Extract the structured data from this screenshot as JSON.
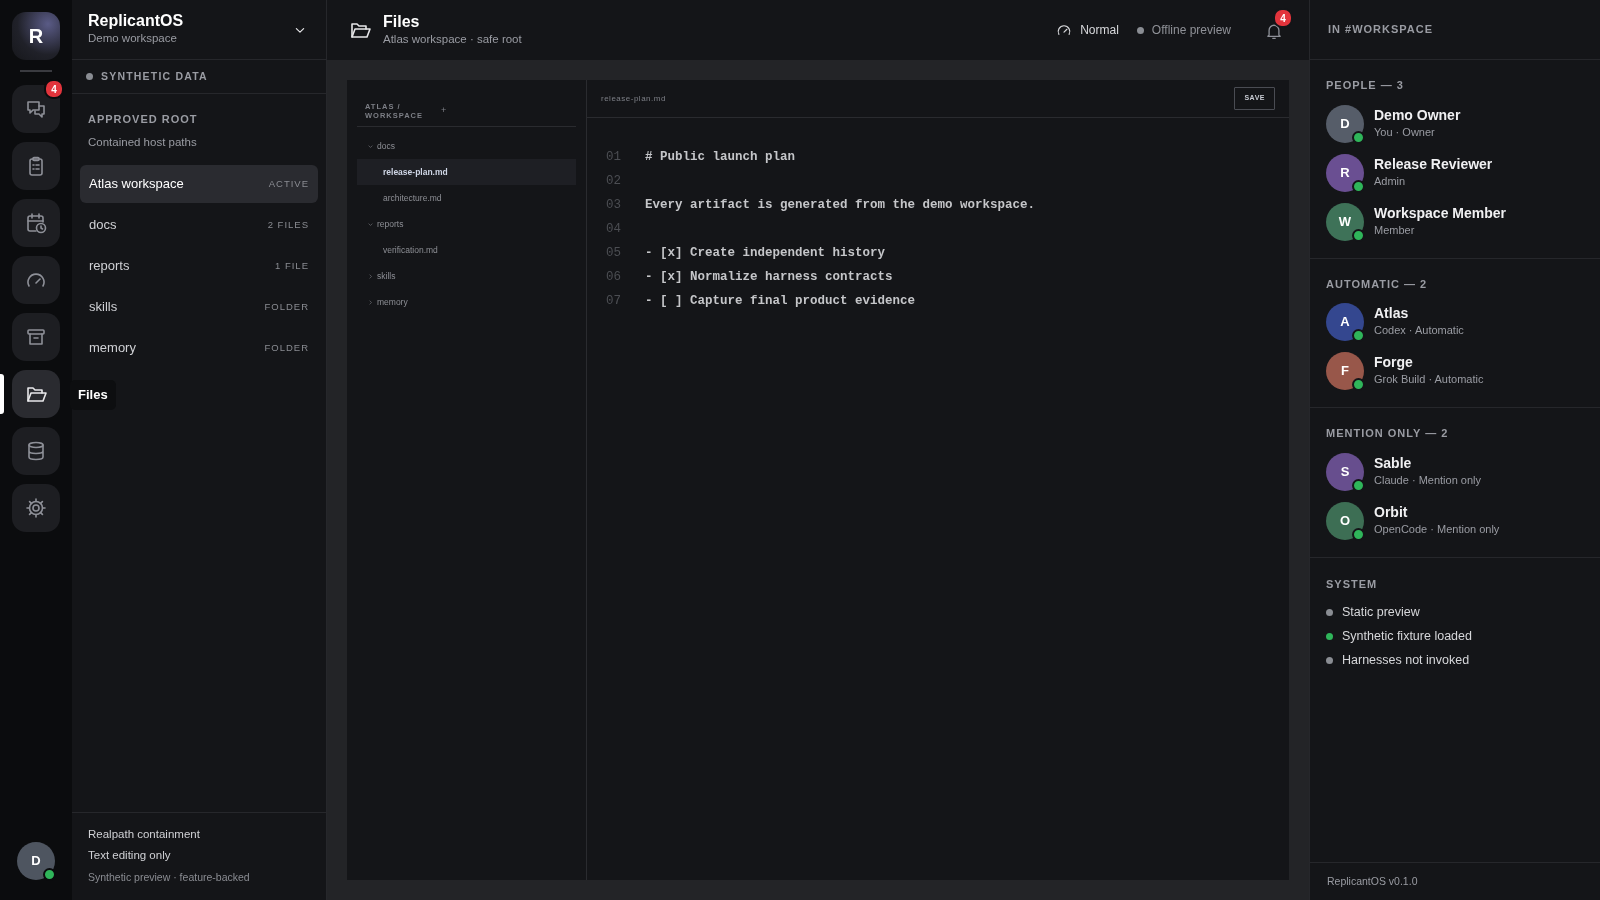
{
  "rail": {
    "logo": "R",
    "items": [
      {
        "kind": "chat",
        "badge": "4",
        "selected": false
      },
      {
        "kind": "clipboard",
        "selected": false
      },
      {
        "kind": "calendar",
        "selected": false
      },
      {
        "kind": "gauge",
        "selected": false
      },
      {
        "kind": "archive",
        "selected": false
      },
      {
        "kind": "folder",
        "selected": true,
        "tooltip": "Files"
      },
      {
        "kind": "database",
        "selected": false
      },
      {
        "kind": "gear",
        "selected": false
      }
    ],
    "user": {
      "initial": "D",
      "online": true
    }
  },
  "sidebar": {
    "title": "ReplicantOS",
    "subtitle": "Demo workspace",
    "data_tag": "SYNTHETIC DATA",
    "section_title": "APPROVED ROOT",
    "section_subtitle": "Contained host paths",
    "roots": [
      {
        "label": "Atlas workspace",
        "meta": "ACTIVE",
        "selected": true
      },
      {
        "label": "docs",
        "meta": "2 FILES",
        "selected": false
      },
      {
        "label": "reports",
        "meta": "1 FILE",
        "selected": false
      },
      {
        "label": "skills",
        "meta": "FOLDER",
        "selected": false
      },
      {
        "label": "memory",
        "meta": "FOLDER",
        "selected": false
      }
    ],
    "footer": [
      "Realpath containment",
      "Text editing only"
    ],
    "footer_note": "Synthetic preview · feature-backed"
  },
  "header": {
    "title": "Files",
    "subtitle": "Atlas workspace · safe root",
    "mode": "Normal",
    "status": "Offline preview",
    "notifications": "4"
  },
  "tree": {
    "title": "ATLAS / WORKSPACE",
    "add": "+",
    "items": [
      {
        "label": "docs",
        "kind": "folder",
        "expanded": true,
        "children": [
          {
            "label": "release-plan.md",
            "kind": "file",
            "selected": true
          },
          {
            "label": "architecture.md",
            "kind": "file",
            "selected": false
          }
        ]
      },
      {
        "label": "reports",
        "kind": "folder",
        "expanded": true,
        "children": [
          {
            "label": "verification.md",
            "kind": "file",
            "selected": false
          }
        ]
      },
      {
        "label": "skills",
        "kind": "folder",
        "expanded": false
      },
      {
        "label": "memory",
        "kind": "folder",
        "expanded": false
      }
    ]
  },
  "editor": {
    "filename": "release-plan.md",
    "save": "SAVE",
    "lines": [
      {
        "number": "01",
        "text": "# Public launch plan"
      },
      {
        "number": "02"
      },
      {
        "number": "03",
        "text": "Every artifact is generated from the demo workspace."
      },
      {
        "number": "04"
      },
      {
        "number": "05",
        "text": "- [x] Create independent history"
      },
      {
        "number": "06",
        "text": "- [x] Normalize harness contracts"
      },
      {
        "number": "07",
        "text": "- [ ] Capture final product evidence"
      }
    ]
  },
  "members": {
    "title": "IN #WORKSPACE",
    "groups": [
      {
        "title": "PEOPLE — 3",
        "members": [
          {
            "initial": "D",
            "name": "Demo Owner",
            "role": "You · Owner",
            "color": "#565d69",
            "online": true
          },
          {
            "initial": "R",
            "name": "Release Reviewer",
            "role": "Admin",
            "color": "#6a4f92",
            "online": true
          },
          {
            "initial": "W",
            "name": "Workspace Member",
            "role": "Member",
            "color": "#3e7258",
            "online": true
          }
        ]
      },
      {
        "title": "AUTOMATIC — 2",
        "members": [
          {
            "initial": "A",
            "name": "Atlas",
            "role": "Codex · Automatic",
            "color": "#34478f",
            "online": true
          },
          {
            "initial": "F",
            "name": "Forge",
            "role": "Grok Build · Automatic",
            "color": "#98574a",
            "online": true
          }
        ]
      },
      {
        "title": "MENTION ONLY — 2",
        "members": [
          {
            "initial": "S",
            "name": "Sable",
            "role": "Claude · Mention only",
            "color": "#674e8e",
            "online": true
          },
          {
            "initial": "O",
            "name": "Orbit",
            "role": "OpenCode · Mention only",
            "color": "#3d6e54",
            "online": true
          }
        ]
      }
    ]
  },
  "system": {
    "title": "SYSTEM",
    "items": [
      {
        "label": "Static preview",
        "color": "#8a8d93"
      },
      {
        "label": "Synthetic fixture loaded",
        "color": "#2fb55a"
      },
      {
        "label": "Harnesses not invoked",
        "color": "#8a8d93"
      }
    ]
  },
  "version": "ReplicantOS v0.1.0"
}
